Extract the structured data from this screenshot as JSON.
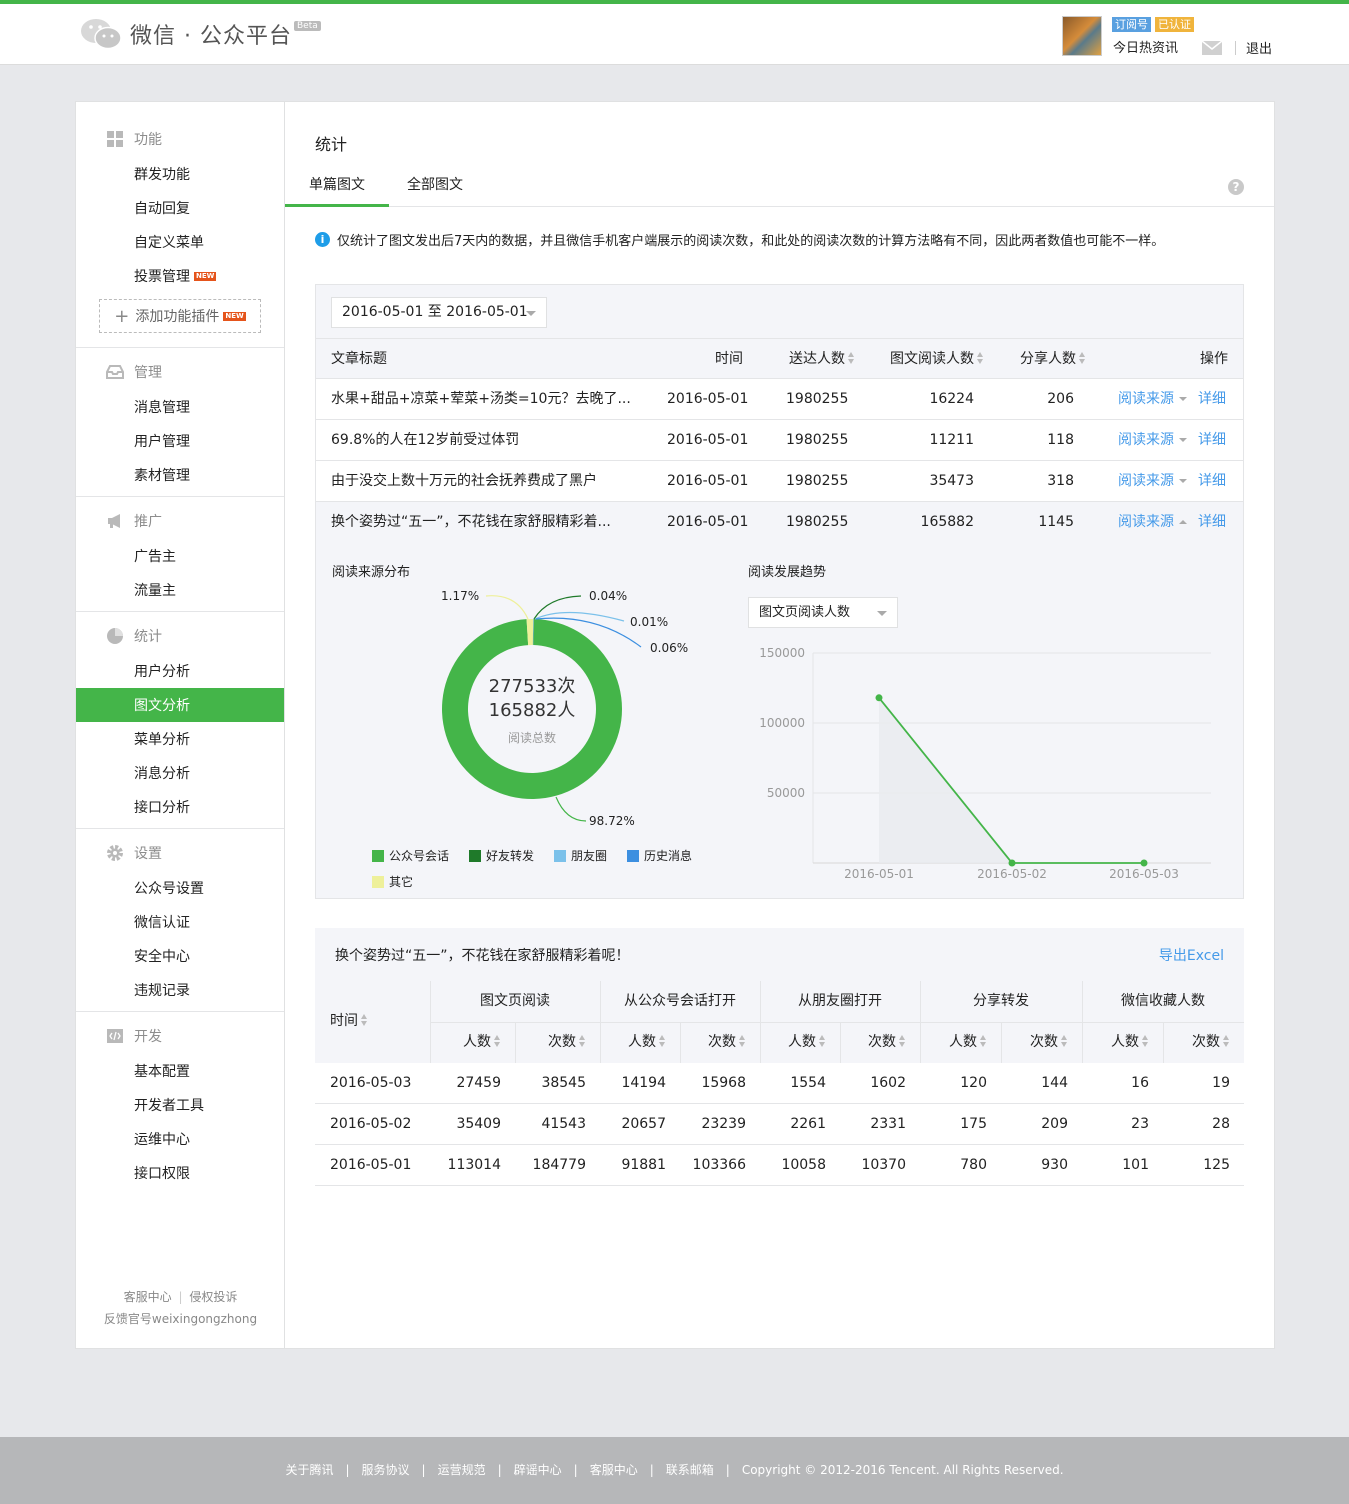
{
  "header": {
    "logo_text": "微信 · 公众平台",
    "beta": "Beta",
    "badge_type": "订阅号",
    "badge_verified": "已认证",
    "account_name": "今日热资讯",
    "logout": "退出",
    "brand_color": "#44b549"
  },
  "sidebar": {
    "sections": [
      {
        "title": "功能",
        "icon": "grid-icon",
        "items": [
          "群发功能",
          "自动回复",
          "自定义菜单",
          "投票管理"
        ],
        "new_item": "投票管理",
        "add_plugin": "添加功能插件"
      },
      {
        "title": "管理",
        "icon": "inbox-icon",
        "items": [
          "消息管理",
          "用户管理",
          "素材管理"
        ]
      },
      {
        "title": "推广",
        "icon": "megaphone-icon",
        "items": [
          "广告主",
          "流量主"
        ]
      },
      {
        "title": "统计",
        "icon": "pie-icon",
        "items": [
          "用户分析",
          "图文分析",
          "菜单分析",
          "消息分析",
          "接口分析"
        ],
        "active": "图文分析"
      },
      {
        "title": "设置",
        "icon": "gear-icon",
        "items": [
          "公众号设置",
          "微信认证",
          "安全中心",
          "违规记录"
        ]
      },
      {
        "title": "开发",
        "icon": "code-icon",
        "items": [
          "基本配置",
          "开发者工具",
          "运维中心",
          "接口权限"
        ]
      }
    ],
    "new_tag": "NEW",
    "footer_link1": "客服中心",
    "footer_link2": "侵权投诉",
    "footer_feedback": "反馈官号weixingongzhong"
  },
  "main": {
    "title": "统计",
    "tabs": [
      "单篇图文",
      "全部图文"
    ],
    "help": "?",
    "notice": "仅统计了图文发出后7天内的数据，并且微信手机客户端展示的阅读次数，和此处的阅读次数的计算方法略有不同，因此两者数值也可能不一样。",
    "date_range": "2016-05-01 至 2016-05-01",
    "article_table": {
      "headers": [
        "文章标题",
        "时间",
        "送达人数",
        "图文阅读人数",
        "分享人数",
        "操作"
      ],
      "action_source": "阅读来源",
      "action_detail": "详细",
      "rows": [
        {
          "title": "水果+甜品+凉菜+荤菜+汤类=10元？去晚了...",
          "date": "2016-05-01",
          "delivered": "1980255",
          "readers": "16224",
          "shares": "206"
        },
        {
          "title": "69.8%的人在12岁前受过体罚",
          "date": "2016-05-01",
          "delivered": "1980255",
          "readers": "11211",
          "shares": "118"
        },
        {
          "title": "由于没交上数十万元的社会抚养费成了黑户",
          "date": "2016-05-01",
          "delivered": "1980255",
          "readers": "35473",
          "shares": "318"
        },
        {
          "title": "换个姿势过“五一”，不花钱在家舒服精彩着...",
          "date": "2016-05-01",
          "delivered": "1980255",
          "readers": "165882",
          "shares": "1145"
        }
      ]
    },
    "donut": {
      "label": "阅读来源分布",
      "center_times": "277533次",
      "center_people": "165882人",
      "center_caption": "阅读总数",
      "slice_labels": [
        "98.72%",
        "0.04%",
        "0.01%",
        "0.06%",
        "1.17%"
      ],
      "legend": [
        "公众号会话",
        "好友转发",
        "朋友圈",
        "历史消息",
        "其它"
      ],
      "colors": [
        "#44b549",
        "#1f7a2a",
        "#7bc1ea",
        "#3c8fe0",
        "#eef09a"
      ]
    },
    "trend": {
      "label": "阅读发展趋势",
      "select": "图文页阅读人数"
    },
    "detail": {
      "title": "换个姿势过“五一”，不花钱在家舒服精彩着呢！",
      "export": "导出Excel",
      "time_header": "时间",
      "groups": [
        "图文页阅读",
        "从公众号会话打开",
        "从朋友圈打开",
        "分享转发",
        "微信收藏人数"
      ],
      "sub_people": "人数",
      "sub_times": "次数",
      "rows": [
        {
          "date": "2016-05-03",
          "values": [
            "27459",
            "38545",
            "14194",
            "15968",
            "1554",
            "1602",
            "120",
            "144",
            "16",
            "19"
          ]
        },
        {
          "date": "2016-05-02",
          "values": [
            "35409",
            "41543",
            "20657",
            "23239",
            "2261",
            "2331",
            "175",
            "209",
            "23",
            "28"
          ]
        },
        {
          "date": "2016-05-01",
          "values": [
            "113014",
            "184779",
            "91881",
            "103366",
            "10058",
            "10370",
            "780",
            "930",
            "101",
            "125"
          ]
        }
      ]
    }
  },
  "chart_data": [
    {
      "type": "pie",
      "title": "阅读来源分布",
      "categories": [
        "公众号会话",
        "好友转发",
        "朋友圈",
        "历史消息",
        "其它"
      ],
      "values": [
        98.72,
        0.04,
        0.01,
        0.06,
        1.17
      ]
    },
    {
      "type": "line",
      "title": "阅读发展趋势",
      "x": [
        "2016-05-01",
        "2016-05-02",
        "2016-05-03"
      ],
      "y": [
        118000,
        0,
        0
      ],
      "ylim": [
        0,
        150000
      ],
      "yticks": [
        "150000",
        "100000",
        "50000"
      ],
      "series": [
        {
          "name": "图文页阅读人数",
          "values": [
            118000,
            0,
            0
          ]
        }
      ],
      "line_color": "#44b549",
      "grid": true
    }
  ],
  "footer": {
    "links": [
      "关于腾讯",
      "服务协议",
      "运营规范",
      "辟谣中心",
      "客服中心",
      "联系邮箱"
    ],
    "copyright": "Copyright © 2012-2016 Tencent. All Rights Reserved."
  }
}
